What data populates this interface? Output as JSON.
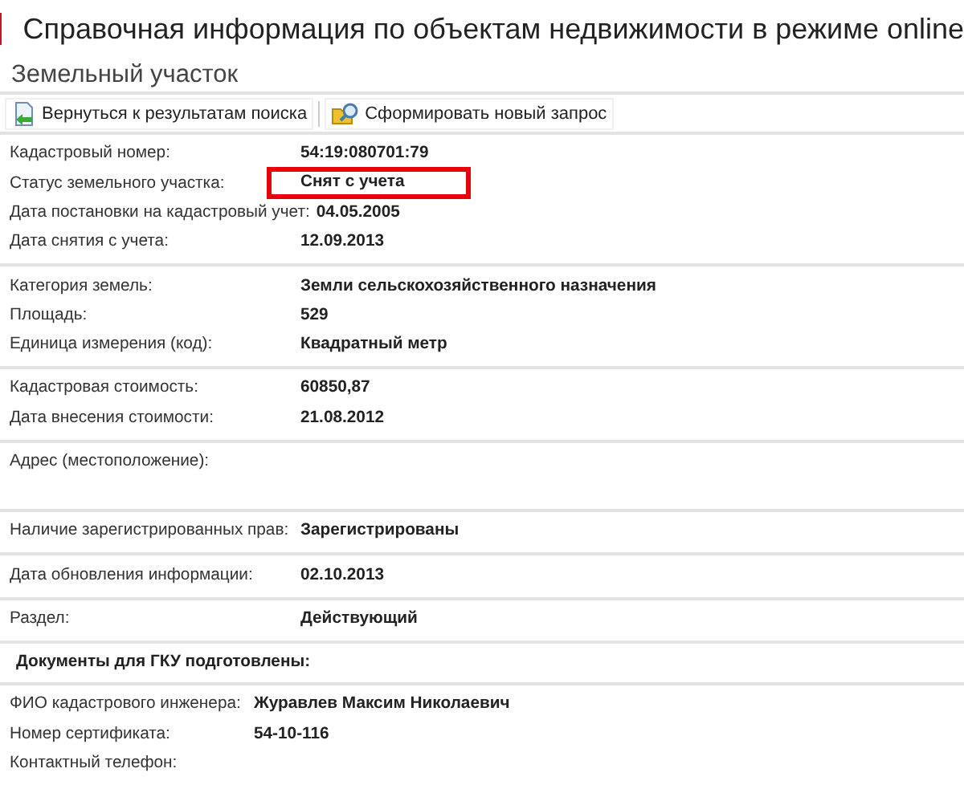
{
  "page_title": "Справочная информация по объектам недвижимости в режиме online",
  "subtitle": "Земельный участок",
  "toolbar": [
    {
      "label": "Вернуться к результатам поиска",
      "kind": "back"
    },
    {
      "label": "Сформировать новый запрос",
      "kind": "query"
    }
  ],
  "sections": [
    {
      "kind": "fields",
      "rows": [
        {
          "label": "Кадастровый номер:",
          "value": "54:19:080701:79",
          "highlighted": false
        },
        {
          "label": "Статус земельного участка:",
          "value": "Снят с учета",
          "highlighted": true
        },
        {
          "label": "Дата постановки на кадастровый учет:",
          "value": "04.05.2005",
          "highlighted": false
        },
        {
          "label": "Дата снятия с учета:",
          "value": "12.09.2013",
          "highlighted": false
        }
      ]
    },
    {
      "kind": "fields",
      "rows": [
        {
          "label": "Категория земель:",
          "value": "Земли сельскохозяйственного назначения",
          "highlighted": false
        },
        {
          "label": "Площадь:",
          "value": "529",
          "highlighted": false
        },
        {
          "label": "Единица измерения (код):",
          "value": "Квадратный метр",
          "highlighted": false
        }
      ]
    },
    {
      "kind": "fields",
      "rows": [
        {
          "label": "Кадастровая стоимость:",
          "value": "60850,87",
          "highlighted": false
        },
        {
          "label": "Дата внесения стоимости:",
          "value": "21.08.2012",
          "highlighted": false
        }
      ]
    },
    {
      "kind": "tall",
      "rows": [
        {
          "label": "Адрес (местоположение):"
        }
      ]
    },
    {
      "kind": "fields",
      "rows": [
        {
          "label": "Наличие зарегистрированных прав:",
          "value": "Зарегистрированы",
          "highlighted": false
        }
      ]
    },
    {
      "kind": "fields",
      "rows": [
        {
          "label": "Дата обновления информации:",
          "value": "02.10.2013",
          "highlighted": false
        }
      ]
    },
    {
      "kind": "fields",
      "rows": [
        {
          "label": "Раздел:",
          "value": "Действующий",
          "highlighted": false
        }
      ]
    },
    {
      "kind": "heading",
      "title": "Документы для ГКУ подготовлены:"
    },
    {
      "kind": "engineer",
      "rows": [
        {
          "label": "ФИО кадастрового инженера:",
          "value": "Журавлев Максим Николаевич",
          "highlighted": false
        },
        {
          "label": "Номер сертификата:",
          "value": "54-10-116",
          "highlighted": false
        },
        {
          "label": "Контактный телефон:"
        }
      ]
    }
  ]
}
